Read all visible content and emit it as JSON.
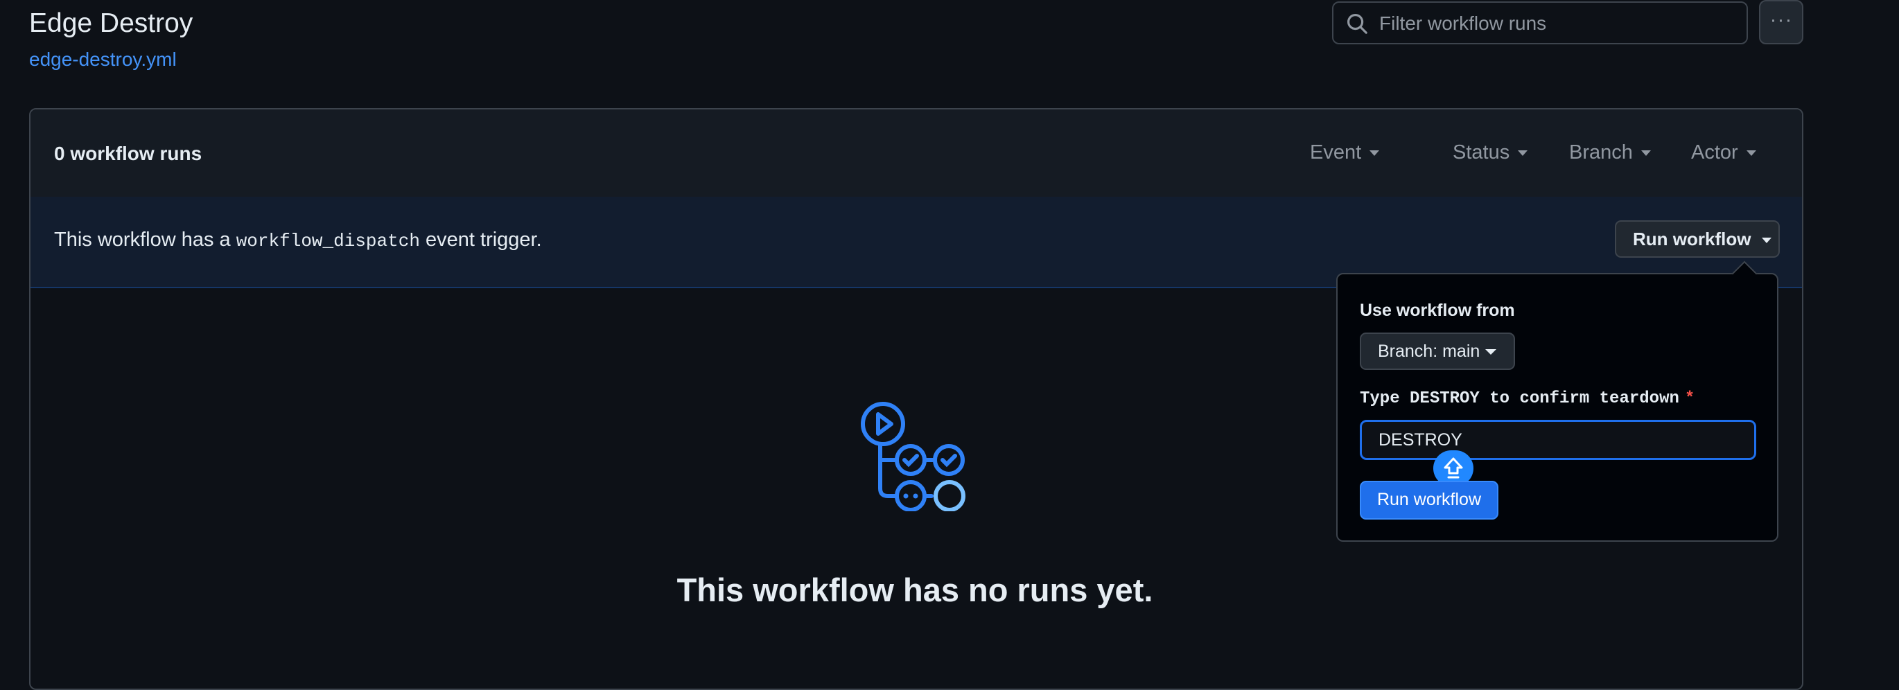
{
  "header": {
    "title": "Edge Destroy",
    "file_link": "edge-destroy.yml",
    "search_placeholder": "Filter workflow runs",
    "more_label": "···"
  },
  "runs": {
    "count_label": "0 workflow runs",
    "filters": [
      "Event",
      "Status",
      "Branch",
      "Actor"
    ]
  },
  "trigger": {
    "text_before": "This workflow has a ",
    "code": "workflow_dispatch",
    "text_after": " event trigger.",
    "run_button": "Run workflow"
  },
  "dispatch_popover": {
    "heading": "Use workflow from",
    "branch_button": "Branch: main",
    "input_label": "Type DESTROY to confirm teardown",
    "required_mark": "*",
    "input_value": "DESTROY",
    "submit_label": "Run workflow"
  },
  "empty_state": {
    "title": "This workflow has no runs yet."
  },
  "icons": {
    "search": "search-icon",
    "caret": "chevron-down-icon",
    "workflow": "workflow-icon",
    "caps_lock": "caps-lock-icon"
  },
  "colors": {
    "background": "#0d1117",
    "accent": "#1f6feb",
    "link": "#4493f8",
    "danger": "#f85149"
  }
}
